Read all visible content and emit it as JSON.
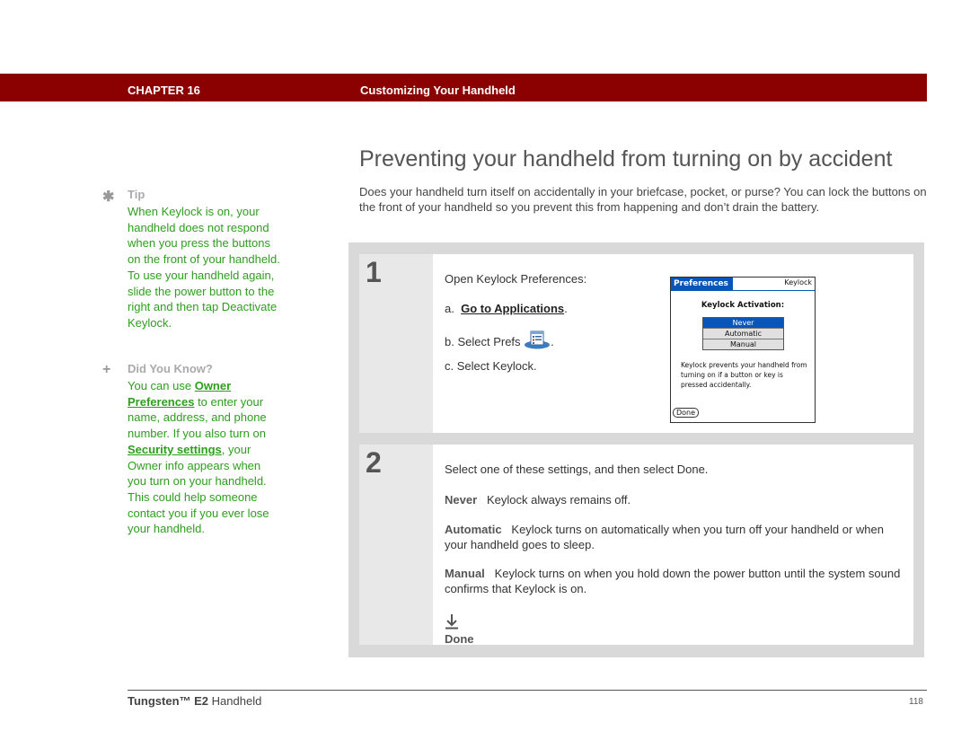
{
  "header": {
    "chapter": "CHAPTER 16",
    "title": "Customizing Your Handheld",
    "bar_color": "#8b0000"
  },
  "page": {
    "title": "Preventing your handheld from turning on by accident",
    "intro": "Does your handheld turn itself on accidentally in your briefcase, pocket, or purse? You can lock the buttons on the front of your handheld so you prevent this from happening and don’t drain the battery."
  },
  "sidebar": {
    "tip": {
      "icon": "asterisk-icon",
      "label": "Tip",
      "text": "When Keylock is on, your handheld does not respond when you press the buttons on the front of your handheld. To use your handheld again, slide the power button to the right and then tap Deactivate Keylock."
    },
    "did_you_know": {
      "icon": "plus-icon",
      "label": "Did You Know?",
      "text_1": "You can use ",
      "link_1": "Owner Preferences",
      "text_2": " to enter your name, address, and phone number. If you also turn on ",
      "link_2": "Security settings",
      "text_3": ", your Owner info appears when you turn on your handheld. This could help someone contact you if you ever lose your handheld."
    },
    "text_color": "#2e9e1e"
  },
  "steps": [
    {
      "number": "1",
      "intro": "Open Keylock Preferences:",
      "a_prefix": "a.",
      "a_link": "Go to Applications",
      "a_suffix": ".",
      "b_text": "b.  Select Prefs",
      "b_suffix": ".",
      "b_icon": "prefs-icon",
      "c_text": "c.  Select Keylock."
    },
    {
      "number": "2",
      "intro": "Select one of these settings, and then select Done.",
      "options": [
        {
          "term": "Never",
          "desc": "Keylock always remains off."
        },
        {
          "term": "Automatic",
          "desc": "Keylock turns on automatically when you turn off your handheld or when your handheld goes to sleep."
        },
        {
          "term": "Manual",
          "desc": "Keylock turns on when you hold down the power button until the system sound confirms that Keylock is on."
        }
      ],
      "done_label": "Done",
      "done_icon": "arrow-down-icon"
    }
  ],
  "palm_screen": {
    "tab": "Preferences",
    "panel": "Keylock",
    "heading": "Keylock Activation:",
    "options": [
      "Never",
      "Automatic",
      "Manual"
    ],
    "selected": "Never",
    "description": "Keylock prevents your handheld from turning on if a button or key is pressed accidentally.",
    "done_button": "Done",
    "accent": "#0a56b8"
  },
  "footer": {
    "product_bold": "Tungsten™ E2",
    "product_rest": " Handheld",
    "page_number": "118"
  }
}
